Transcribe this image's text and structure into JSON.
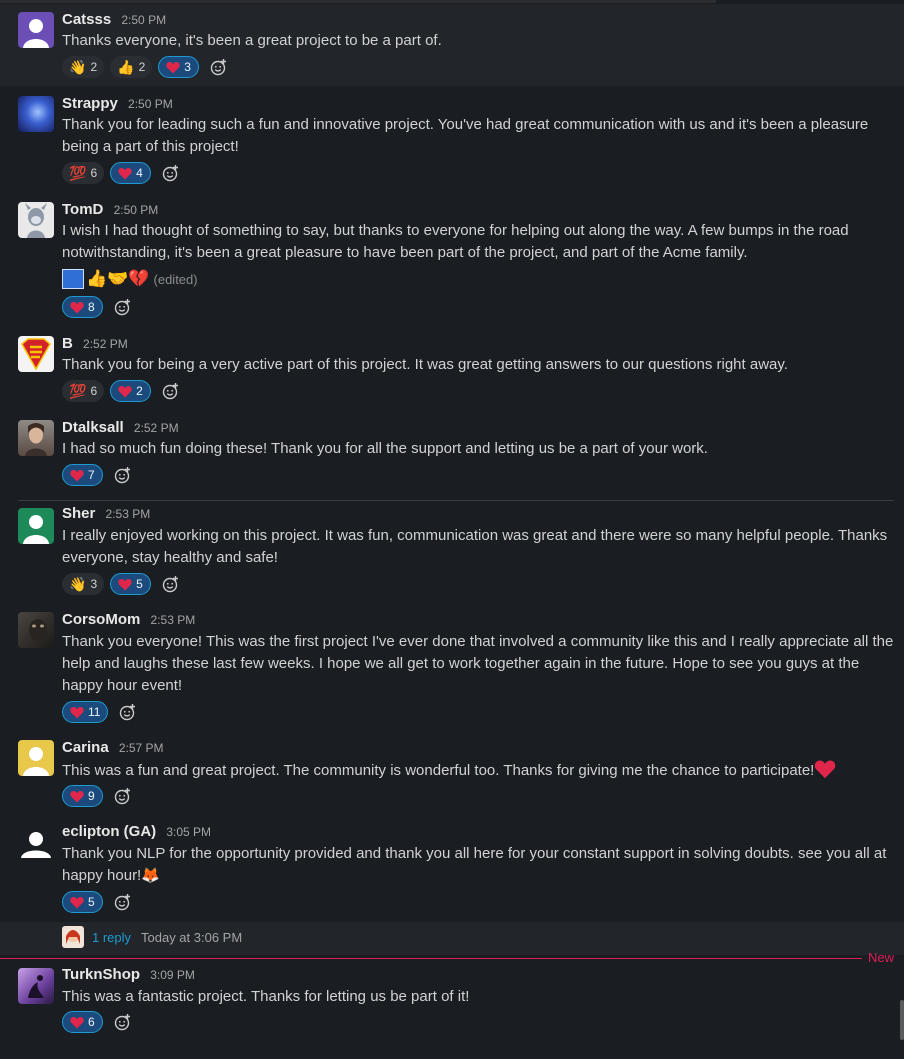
{
  "messages": [
    {
      "name": "Catsss",
      "time": "2:50 PM",
      "text": "Thanks everyone, it's been a great project to be a part of.",
      "reactions": [
        {
          "emoji": "👋",
          "count": "2",
          "mine": false
        },
        {
          "emoji": "👍",
          "count": "2",
          "mine": false
        },
        {
          "emoji": "heart",
          "count": "3",
          "mine": true
        }
      ]
    },
    {
      "name": "Strappy",
      "time": "2:50 PM",
      "text": "Thank you for leading such a fun and innovative project. You've had great communication with us and it's been a pleasure being a part of this project!",
      "reactions": [
        {
          "emoji": "💯",
          "count": "6",
          "mine": false
        },
        {
          "emoji": "heart",
          "count": "4",
          "mine": true
        }
      ]
    },
    {
      "name": "TomD",
      "time": "2:50 PM",
      "text": "I wish I had thought of something to say, but thanks to everyone for helping out along the way.  A few bumps in the road notwithstanding, it's been a great pleasure to have been part of the project, and part of the Acme family.",
      "inline_emoji": "👍🤝💔",
      "edited": "(edited)",
      "reactions": [
        {
          "emoji": "heart",
          "count": "8",
          "mine": true
        }
      ]
    },
    {
      "name": "B",
      "time": "2:52 PM",
      "text": "Thank you for being a very active part of this project. It was great getting answers to our questions right away.",
      "reactions": [
        {
          "emoji": "💯",
          "count": "6",
          "mine": false
        },
        {
          "emoji": "heart",
          "count": "2",
          "mine": true
        }
      ]
    },
    {
      "name": "Dtalksall",
      "time": "2:52 PM",
      "text": "I had so much fun doing these! Thank you for all the support and letting us be a part of your work.",
      "reactions": [
        {
          "emoji": "heart",
          "count": "7",
          "mine": true
        }
      ]
    },
    {
      "name": "Sher",
      "time": "2:53 PM",
      "text": "I really enjoyed working on this project. It was fun, communication was great and there were so many helpful people. Thanks everyone, stay healthy and safe!",
      "reactions": [
        {
          "emoji": "👋",
          "count": "3",
          "mine": false
        },
        {
          "emoji": "heart",
          "count": "5",
          "mine": true
        }
      ]
    },
    {
      "name": "CorsoMom",
      "time": "2:53 PM",
      "text": "Thank you everyone! This was the first project I've ever done that involved a community like this and I really appreciate all the help and laughs these last few weeks. I hope we all get to work together again in the future. Hope to see you guys at the happy hour event!",
      "reactions": [
        {
          "emoji": "heart",
          "count": "11",
          "mine": true
        }
      ]
    },
    {
      "name": "Carina",
      "time": "2:57 PM",
      "text": "This was a fun and great project. The community is wonderful too. Thanks for giving me the chance to participate!",
      "reactions": [
        {
          "emoji": "heart",
          "count": "9",
          "mine": true
        }
      ]
    },
    {
      "name": "eclipton (GA)",
      "time": "3:05 PM",
      "text": "Thank you NLP  for the opportunity provided and thank you all here for your constant support in solving doubts. see you all at happy hour!🦊",
      "reactions": [
        {
          "emoji": "heart",
          "count": "5",
          "mine": true
        }
      ]
    },
    {
      "name": "TurknShop",
      "time": "3:09 PM",
      "text": "This was a fantastic project. Thanks for letting us be part of it!",
      "reactions": [
        {
          "emoji": "heart",
          "count": "6",
          "mine": true
        }
      ]
    }
  ],
  "thread": {
    "reply_label": "1 reply",
    "time": "Today at 3:06 PM"
  },
  "new_marker": "New",
  "colors": {
    "background": "#1a1d21",
    "link": "#1d9bd1",
    "new": "#e01e5a",
    "reaction_mine": "#1d4a7c"
  }
}
